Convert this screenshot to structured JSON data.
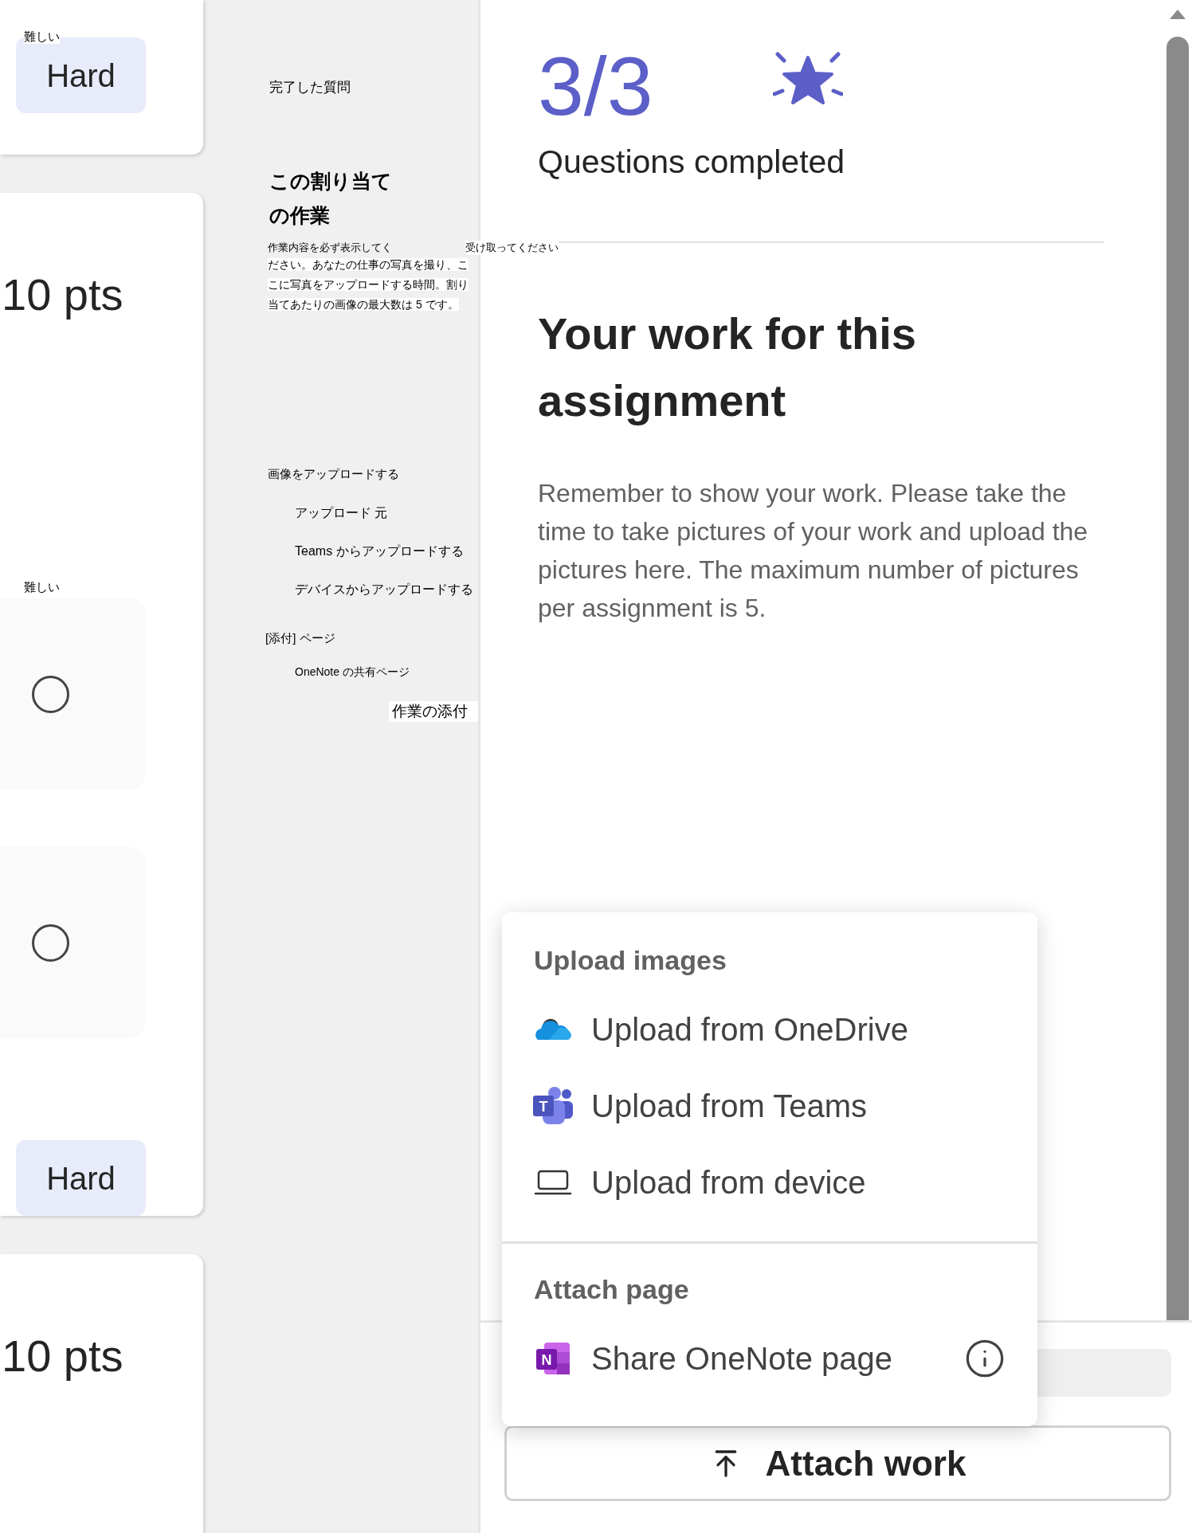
{
  "left_cards": [
    {
      "kind": "difficulty",
      "difficulty_note": "難しい",
      "difficulty": "Hard"
    },
    {
      "kind": "question",
      "points": "10 pts",
      "difficulty_note": "難しい",
      "options": [
        {
          "selected": false
        },
        {
          "selected": false
        }
      ],
      "difficulty": "Hard"
    },
    {
      "kind": "points",
      "points": "10 pts"
    }
  ],
  "translation_panel": {
    "completed_label": "完了した質問",
    "heading": "この割り当ての作業",
    "paragraph_start": "作業内容を必ず表示してく",
    "paragraph_aside": "受け取ってください",
    "paragraph_rest": "ださい。あなたの仕事の写真を撮り、ここに写真をアップロードする時間。割り当てあたりの画像の最大数は 5 です。",
    "upload_heading": "画像をアップロードする",
    "upload_items": [
      "アップロード 元",
      "Teams からアップロードする",
      "デバイスからアップロードする"
    ],
    "attach_heading": "[添付] ページ",
    "attach_items": [
      "OneNote の共有ページ"
    ],
    "attach_button": "作業の添付"
  },
  "progress": {
    "count": "3/3",
    "label": "Questions completed"
  },
  "work": {
    "title": "Your work for this assignment",
    "instructions": "Remember to show your work. Please take the time to take pictures of your work and upload the pictures here. The maximum number of pictures per assignment is 5."
  },
  "menu": {
    "sections": [
      {
        "title": "Upload images",
        "items": [
          {
            "label": "Upload from OneDrive",
            "kind": "onedrive",
            "info": false
          },
          {
            "label": "Upload from Teams",
            "kind": "teams",
            "icon_letter": "T",
            "info": false
          },
          {
            "label": "Upload from device",
            "kind": "device",
            "info": false
          }
        ]
      },
      {
        "title": "Attach page",
        "items": [
          {
            "label": "Share OneNote page",
            "kind": "onenote",
            "icon_letter": "N",
            "info": true
          }
        ]
      }
    ]
  },
  "attach_button": {
    "label": "Attach work"
  }
}
